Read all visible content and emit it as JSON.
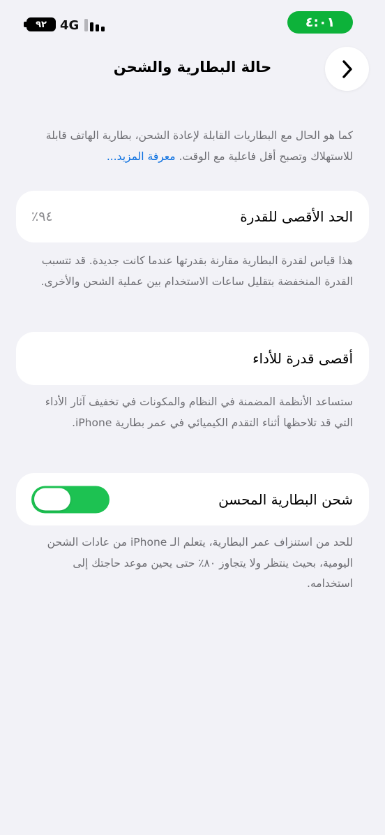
{
  "status_bar": {
    "time": "٤:٠١",
    "network": "4G",
    "battery_level": "٩٢",
    "icons": [
      "battery-icon",
      "signal-icon"
    ],
    "time_pill_color": "#0DB23A"
  },
  "nav": {
    "title": "حالة البطارية والشحن",
    "back_icon": "chevron-icon"
  },
  "intro": {
    "text": "كما هو الحال مع البطاريات القابلة لإعادة الشحن، بطارية الهاتف قابلة للاستهلاك وتصبح أقل فاعلية مع الوقت.",
    "link": "معرفة المزيد..."
  },
  "maximum_capacity": {
    "label": "الحد الأقصى للقدرة",
    "value": "٩٤٪",
    "description": "هذا قياس لقدرة البطارية مقارنة بقدرتها عندما كانت جديدة. قد تتسبب القدرة المنخفضة بتقليل ساعات الاستخدام بين عملية الشحن والأخرى."
  },
  "peak_performance": {
    "label": "أقصى قدرة للأداء",
    "description": "ستساعد الأنظمة المضمنة في النظام والمكونات في تخفيف آثار الأداء التي قد تلاحظها أثناء التقدم الكيميائي في عمر بطارية iPhone."
  },
  "optimized_charging": {
    "label": "شحن البطارية المحسن",
    "enabled": true,
    "toggle_color": "#1DC252",
    "description": "للحد من استنزاف عمر البطارية، يتعلم الـ iPhone من عادات الشحن اليومية، بحيث ينتظر ولا يتجاوز ٨٠٪ حتى يحين موعد حاجتك إلى استخدامه."
  },
  "colors": {
    "background": "#F2F2F7",
    "link": "#0A6FE0",
    "secondary_text": "#6D6D72"
  }
}
